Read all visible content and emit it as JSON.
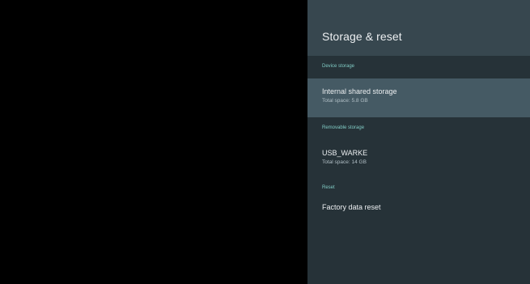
{
  "panel": {
    "title": "Storage & reset"
  },
  "sections": {
    "device": {
      "header": "Device storage",
      "item": {
        "title": "Internal shared storage",
        "summary": "Total space: 5.8 GB"
      }
    },
    "removable": {
      "header": "Removable storage",
      "item": {
        "title": "USB_WARKE",
        "summary": "Total space: 14 GB"
      }
    },
    "reset": {
      "header": "Reset",
      "item": {
        "title": "Factory data reset"
      }
    }
  },
  "colors": {
    "panel_background": "#263238",
    "header_background": "#37474f",
    "focused_item": "#455a64",
    "section_header": "#80cbc4"
  }
}
